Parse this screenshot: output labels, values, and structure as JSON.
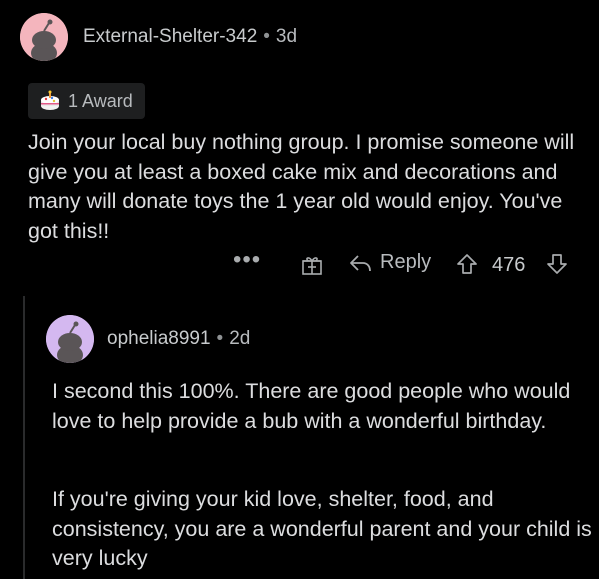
{
  "comment1": {
    "username": "External-Shelter-342",
    "age": "3d",
    "award_label": "1 Award",
    "body": "Join your local buy nothing group. I promise someone will give you at least a boxed cake mix and decorations and many will donate toys the 1 year old would enjoy. You've got this!!",
    "actions": {
      "more": "•••",
      "reply_label": "Reply",
      "score": "476"
    },
    "avatar_color": "#f4b5bd"
  },
  "comment2": {
    "username": "ophelia8991",
    "age": "2d",
    "body_paragraphs": [
      "I second this 100%. There are good people who would love to help provide a bub with a wonderful birthday.",
      "If you're giving your kid love, shelter, food, and consistency, you are a wonderful parent and your child is very lucky"
    ],
    "avatar_color": "#d4b8f0"
  },
  "separator": "•"
}
